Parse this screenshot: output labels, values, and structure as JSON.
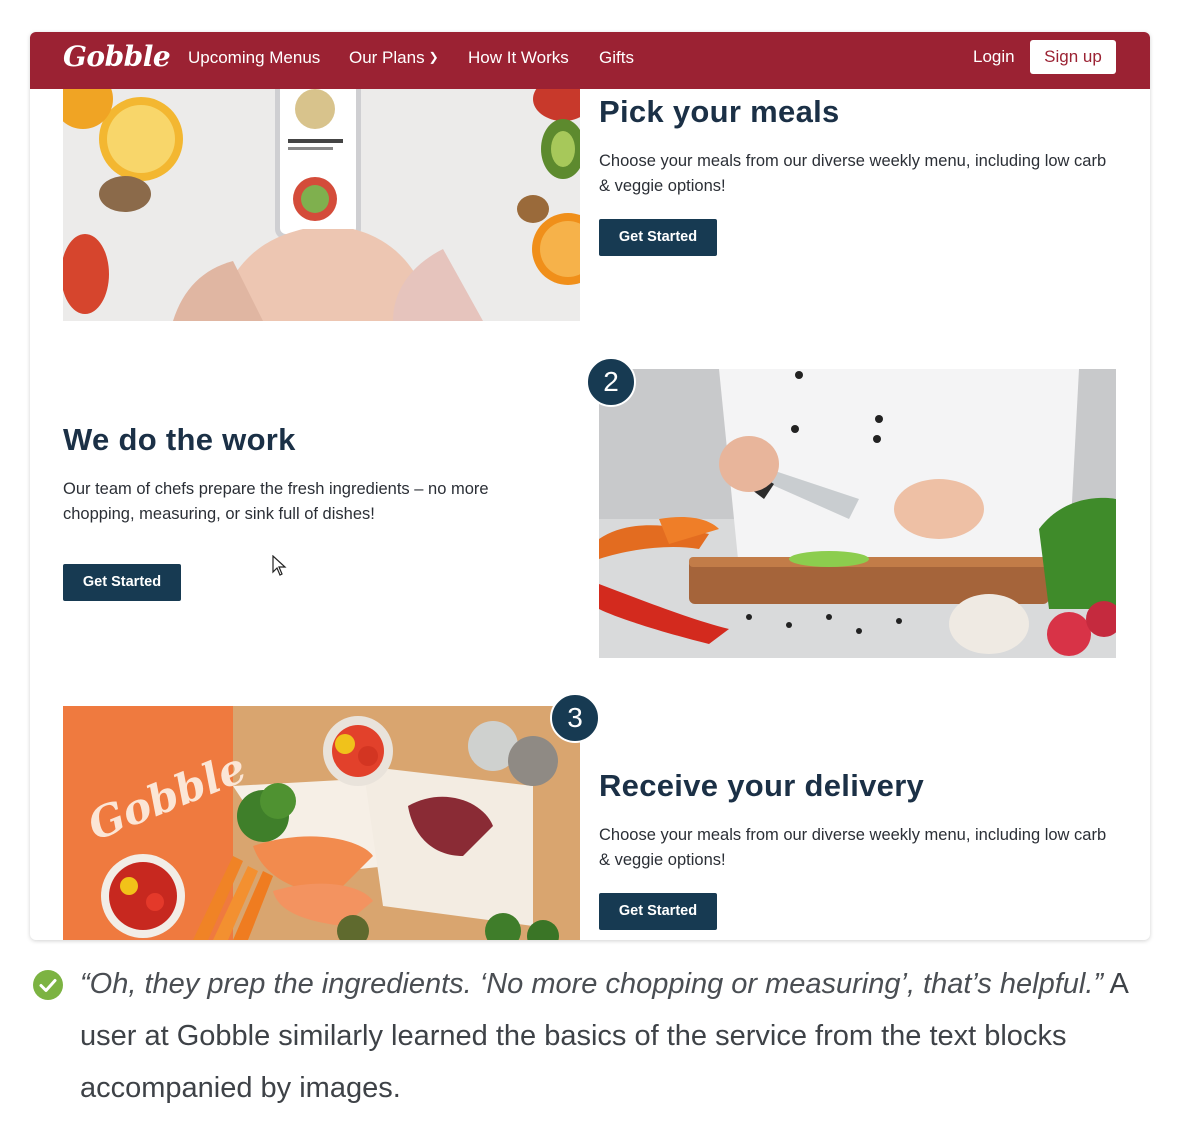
{
  "nav": {
    "logo": "Gobble",
    "links": [
      "Upcoming Menus",
      "Our Plans",
      "How It Works",
      "Gifts"
    ],
    "login": "Login",
    "signup": "Sign up"
  },
  "sections": [
    {
      "title": "Pick your meals",
      "text": "Choose your meals from our diverse weekly menu, including low carb & veggie options!",
      "button": "Get Started"
    },
    {
      "step": "2",
      "title": "We do the work",
      "text": "Our team of chefs prepare the fresh ingredients – no more chopping, measuring, or sink full of dishes!",
      "button": "Get Started"
    },
    {
      "step": "3",
      "title": "Receive your delivery",
      "text": "Choose your meals from our diverse weekly menu, including low carb & veggie options!",
      "button": "Get Started"
    }
  ],
  "box_brand": "Gobble",
  "caption": {
    "quote": "“Oh, they prep the ingredients. ‘No more chopping or measuring’, that’s helpful.”",
    "text": " A user at Gobble similarly learned the basics of the service from the text blocks accompanied by images."
  },
  "colors": {
    "brand": "#9b2233",
    "navy": "#173a52",
    "check": "#7cb342"
  },
  "icons": [
    "chevron-down-icon",
    "cursor-icon",
    "check-circle-icon"
  ]
}
